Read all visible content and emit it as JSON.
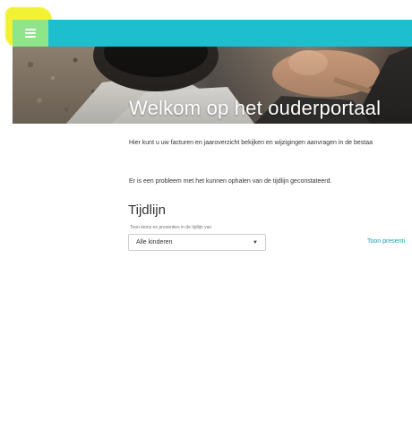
{
  "colors": {
    "topbar": "#1dbfcf",
    "menu_button": "#8ee58a",
    "highlight": "#f1f233",
    "link": "#1a9fb0"
  },
  "header": {
    "menu_icon": "hamburger-icon"
  },
  "hero": {
    "title": "Welkom op het ouderportaal"
  },
  "main": {
    "intro_text": "Hier kunt u uw facturen en jaaroverzicht bekijken en wijzigingen aanvragen in de bestaa",
    "error_text": "Er is een probleem met het kunnen ophalen van de tijdlijn geconstateerd.",
    "timeline": {
      "title": "Tijdlijn",
      "filter_label": "Toon items en presenties in de tijdlijn van",
      "select_value": "Alle kinderen",
      "show_link": "Toon presenti"
    }
  }
}
